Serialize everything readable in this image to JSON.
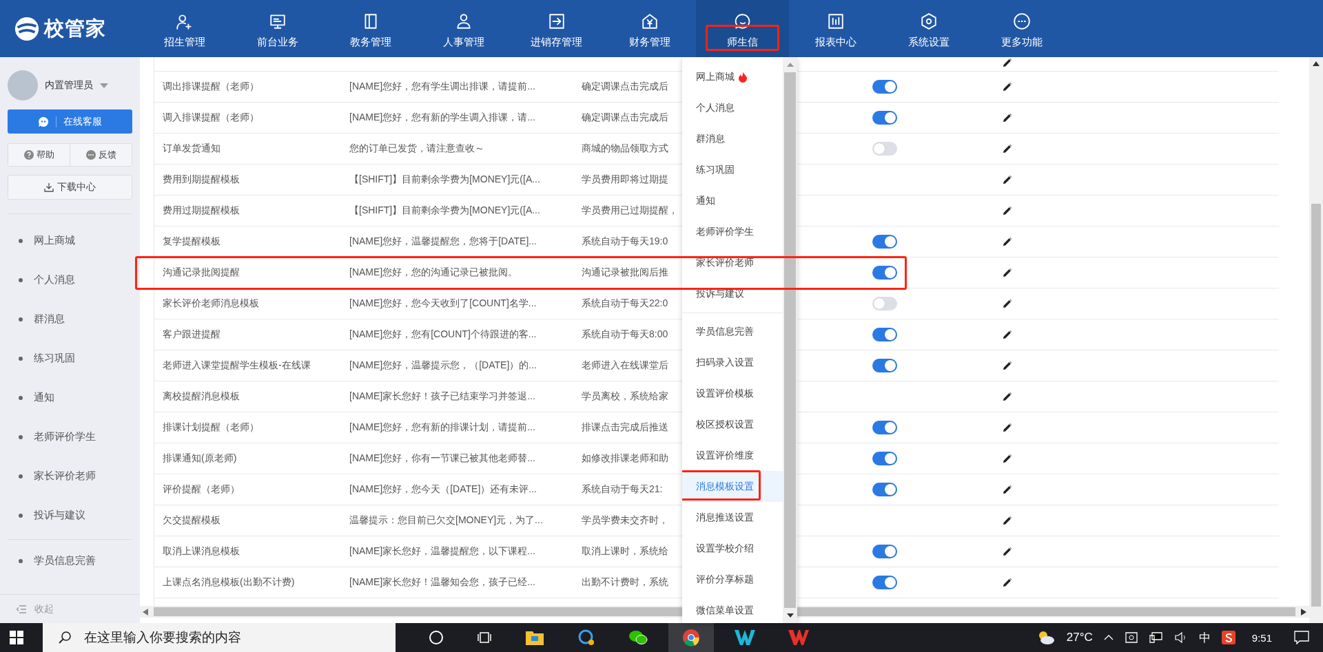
{
  "app": {
    "logo": "校管家"
  },
  "nav": [
    {
      "label": "招生管理",
      "selected": false,
      "annotated": false
    },
    {
      "label": "前台业务",
      "selected": false,
      "annotated": false
    },
    {
      "label": "教务管理",
      "selected": false,
      "annotated": false
    },
    {
      "label": "人事管理",
      "selected": false,
      "annotated": false
    },
    {
      "label": "进销存管理",
      "selected": false,
      "annotated": false
    },
    {
      "label": "财务管理",
      "selected": false,
      "annotated": false
    },
    {
      "label": "师生信",
      "selected": true,
      "annotated": true
    },
    {
      "label": "报表中心",
      "selected": false,
      "annotated": false
    },
    {
      "label": "系统设置",
      "selected": false,
      "annotated": false
    },
    {
      "label": "更多功能",
      "selected": false,
      "annotated": false
    }
  ],
  "sidebar": {
    "user": "内置管理员",
    "service_button": "在线客服",
    "help_button": "帮助",
    "feedback_button": "反馈",
    "download_button": "下载中心",
    "items": [
      "网上商城",
      "个人消息",
      "群消息",
      "练习巩固",
      "通知",
      "老师评价学生",
      "家长评价老师",
      "投诉与建议"
    ],
    "items_2": [
      "学员信息完善"
    ],
    "collapse": "收起"
  },
  "table": {
    "rows": [
      {
        "name": "调出排课提醒（老师）",
        "template": "[NAME]您好，您有学生调出排课，请提前...",
        "description": "确定调课点击完成后",
        "switch_on": true,
        "annotated": false
      },
      {
        "name": "调入排课提醒（老师）",
        "template": "[NAME]您好，您有新的学生调入排课，请...",
        "description": "确定调课点击完成后",
        "switch_on": true,
        "annotated": false
      },
      {
        "name": "订单发货通知",
        "template": "您的订单已发货，请注意查收～",
        "description": "商城的物品领取方式",
        "switch_on": false,
        "annotated": false
      },
      {
        "name": "费用到期提醒模板",
        "template": "【[SHIFT]】目前剩余学费为[MONEY]元([A...",
        "description": "学员费用即将过期提",
        "annotated": false
      },
      {
        "name": "费用过期提醒模板",
        "template": "【[SHIFT]】目前剩余学费为[MONEY]元([A...",
        "description": "学员费用已过期提醒，",
        "annotated": false
      },
      {
        "name": "复学提醒模板",
        "template": "[NAME]您好，温馨提醒您，您将于[DATE]...",
        "description": "系统自动于每天19:0",
        "switch_on": true,
        "annotated": false
      },
      {
        "name": "沟通记录批阅提醒",
        "template": "[NAME]您好，您的沟通记录已被批阅。",
        "description": "沟通记录被批阅后推",
        "switch_on": true,
        "annotated": true
      },
      {
        "name": "家长评价老师消息模板",
        "template": "[NAME]您好，您今天收到了[COUNT]名学...",
        "description": "系统自动于每天22:0",
        "switch_on": false,
        "annotated": false
      },
      {
        "name": "客户跟进提醒",
        "template": "[NAME]您好，您有[COUNT]个待跟进的客...",
        "description": "系统自动于每天8:00",
        "switch_on": true,
        "annotated": false
      },
      {
        "name": "老师进入课堂提醒学生模板-在线课",
        "template": "[NAME]您好，温馨提示您，（[DATE]）的...",
        "description": "老师进入在线课堂后",
        "switch_on": true,
        "annotated": false
      },
      {
        "name": "离校提醒消息模板",
        "template": "[NAME]家长您好！孩子已结束学习并签退...",
        "description": "学员离校，系统给家",
        "annotated": false
      },
      {
        "name": "排课计划提醒（老师）",
        "template": "[NAME]您好，您有新的排课计划，请提前...",
        "description": "排课点击完成后推送",
        "switch_on": true,
        "annotated": false
      },
      {
        "name": "排课通知(原老师)",
        "template": "[NAME]您好，你有一节课已被其他老师替...",
        "description": "如修改排课老师和助",
        "switch_on": true,
        "annotated": false
      },
      {
        "name": "评价提醒（老师）",
        "template": "[NAME]您好，您今天（[DATE]）还有未评...",
        "description": "系统自动于每天21:",
        "switch_on": true,
        "annotated": false
      },
      {
        "name": "欠交提醒模板",
        "template": "温馨提示：您目前已欠交[MONEY]元，为了...",
        "description": "学员学费未交齐时，",
        "annotated": false
      },
      {
        "name": "取消上课消息模板",
        "template": "[NAME]家长您好，温馨提醒您，以下课程...",
        "description": "取消上课时，系统给",
        "switch_on": true,
        "annotated": false
      },
      {
        "name": "上课点名消息模板(出勤不计费)",
        "template": "[NAME]家长您好！温馨知会您，孩子已经...",
        "description": "出勤不计费时，系统",
        "switch_on": true,
        "annotated": false
      }
    ]
  },
  "dropdown": {
    "items": [
      {
        "label": "网上商城",
        "hot": true,
        "selected": false,
        "annotated": false
      },
      {
        "label": "个人消息",
        "hot": false,
        "selected": false,
        "annotated": false
      },
      {
        "label": "群消息",
        "hot": false,
        "selected": false,
        "annotated": false
      },
      {
        "label": "练习巩固",
        "hot": false,
        "selected": false,
        "annotated": false
      },
      {
        "label": "通知",
        "hot": false,
        "selected": false,
        "annotated": false
      },
      {
        "label": "老师评价学生",
        "hot": false,
        "selected": false,
        "annotated": false
      },
      {
        "label": "家长评价老师",
        "hot": false,
        "selected": false,
        "annotated": false
      },
      {
        "label": "投诉与建议",
        "hot": false,
        "selected": false,
        "annotated": false
      }
    ],
    "items_2": [
      {
        "label": "学员信息完善",
        "selected": false,
        "annotated": false
      },
      {
        "label": "扫码录入设置",
        "selected": false,
        "annotated": false
      },
      {
        "label": "设置评价模板",
        "selected": false,
        "annotated": false
      },
      {
        "label": "校区授权设置",
        "selected": false,
        "annotated": false
      },
      {
        "label": "设置评价维度",
        "selected": false,
        "annotated": false
      },
      {
        "label": "消息模板设置",
        "selected": true,
        "annotated": true
      },
      {
        "label": "消息推送设置",
        "selected": false,
        "annotated": false
      },
      {
        "label": "设置学校介绍",
        "selected": false,
        "annotated": false
      },
      {
        "label": "评价分享标题",
        "selected": false,
        "annotated": false
      },
      {
        "label": "微信菜单设置",
        "selected": false,
        "annotated": false
      }
    ]
  },
  "taskbar": {
    "search_placeholder": "在这里输入你要搜索的内容",
    "temperature": "27°C",
    "ime": "中",
    "time": "9:51"
  }
}
